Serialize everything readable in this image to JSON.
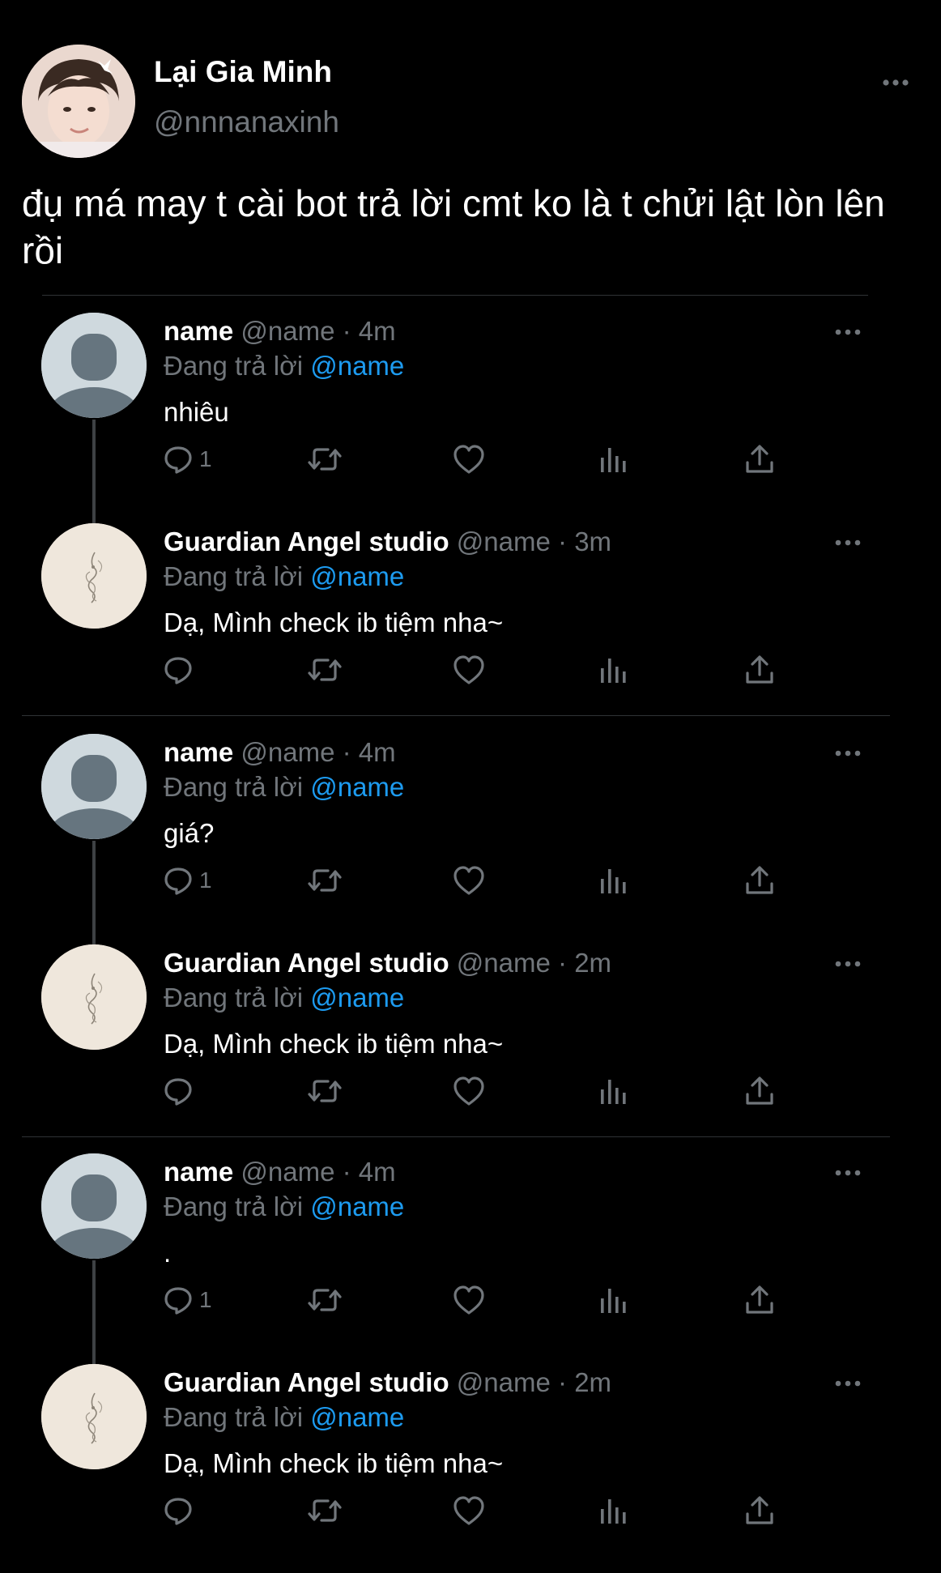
{
  "author": {
    "name": "Lại Gia Minh",
    "handle": "@nnnanaxinh",
    "avatar_icon": "profile-photo-icon",
    "more_icon": "more-options-icon"
  },
  "tweet": {
    "text": "đụ má may t cài bot trả lời cmt ko là t chửi lật lòn lên rồi"
  },
  "colors": {
    "background": "#000000",
    "text": "#e7e9ea",
    "secondary": "#71767b",
    "mention": "#1d9bf0",
    "divider": "#2f3336"
  },
  "threads": [
    {
      "question": {
        "name": "name",
        "handle": "@name",
        "time": "· 4m",
        "replying_label": "Đang trả lời",
        "replying_to": "@name",
        "text": "nhiêu",
        "reply_count": "1"
      },
      "answer": {
        "name": "Guardian Angel studio",
        "handle": "@name",
        "time": "· 3m",
        "replying_label": "Đang trả lời",
        "replying_to": "@name",
        "text": "Dạ, Mình check ib tiệm nha~",
        "reply_count": ""
      }
    },
    {
      "question": {
        "name": "name",
        "handle": "@name",
        "time": "· 4m",
        "replying_label": "Đang trả lời",
        "replying_to": "@name",
        "text": "giá?",
        "reply_count": "1"
      },
      "answer": {
        "name": "Guardian Angel studio",
        "handle": "@name",
        "time": "· 2m",
        "replying_label": "Đang trả lời",
        "replying_to": "@name",
        "text": "Dạ, Mình check ib tiệm nha~",
        "reply_count": ""
      }
    },
    {
      "question": {
        "name": "name",
        "handle": "@name",
        "time": "· 4m",
        "replying_label": "Đang trả lời",
        "replying_to": "@name",
        "text": ".",
        "reply_count": "1"
      },
      "answer": {
        "name": "Guardian Angel studio",
        "handle": "@name",
        "time": "· 2m",
        "replying_label": "Đang trả lời",
        "replying_to": "@name",
        "text": "Dạ, Mình check ib tiệm nha~",
        "reply_count": ""
      }
    }
  ],
  "action_icons": [
    "reply-icon",
    "retweet-icon",
    "like-icon",
    "analytics-icon",
    "share-icon"
  ]
}
